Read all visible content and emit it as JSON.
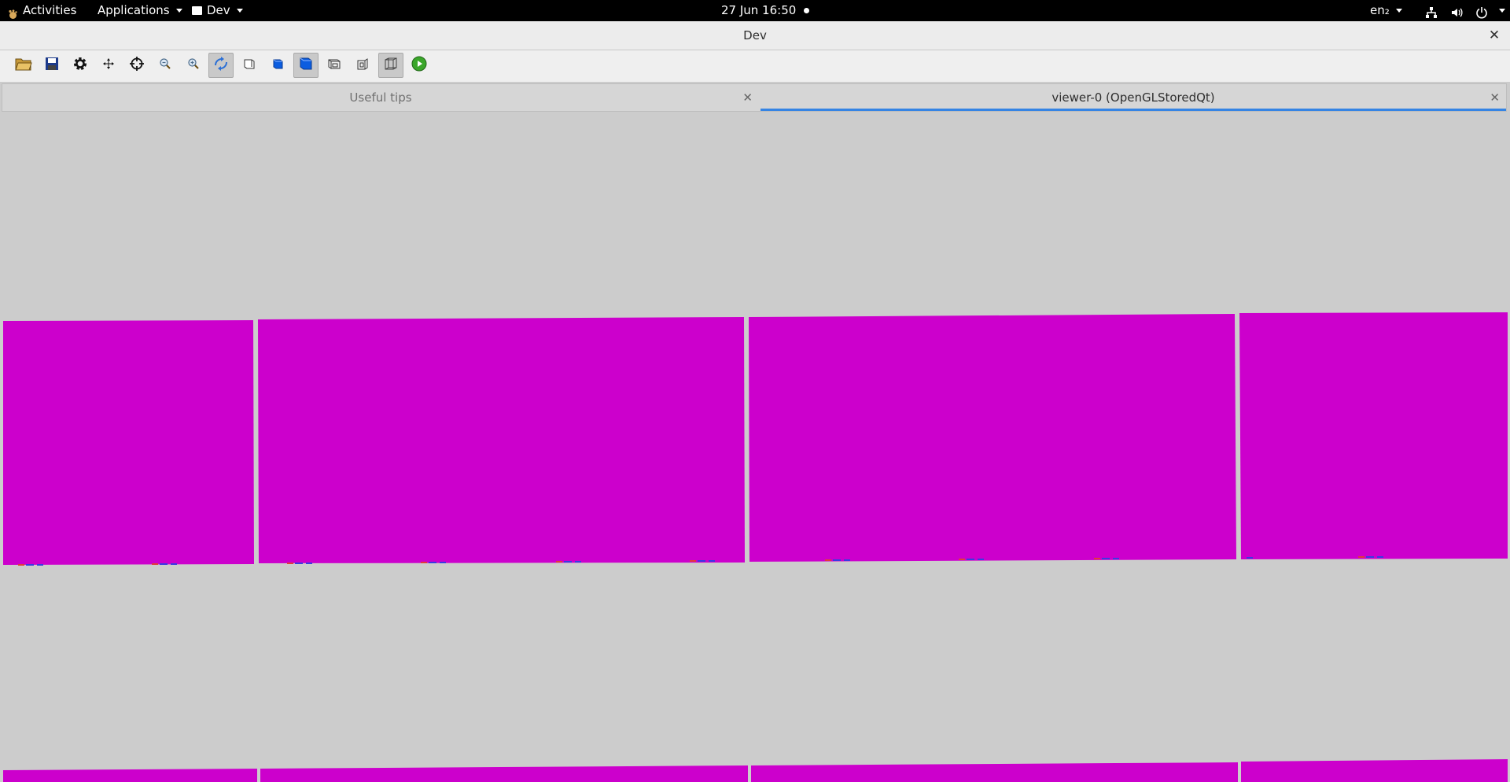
{
  "topbar": {
    "activities": "Activities",
    "applications": "Applications",
    "app_menu": "Dev",
    "clock": "27 Jun  16:50",
    "keyboard_layout": "en₂"
  },
  "window": {
    "title": "Dev"
  },
  "toolbar": {
    "buttons": [
      {
        "name": "open-icon"
      },
      {
        "name": "save-icon"
      },
      {
        "name": "settings-icon"
      },
      {
        "name": "move-icon"
      },
      {
        "name": "pick-target-icon"
      },
      {
        "name": "zoom-out-icon"
      },
      {
        "name": "zoom-in-icon"
      },
      {
        "name": "rotate-icon",
        "pressed": true
      },
      {
        "name": "hidden-line-icon"
      },
      {
        "name": "solid-surface-icon"
      },
      {
        "name": "solid-surface-selected-icon",
        "pressed": true
      },
      {
        "name": "perspective-icon"
      },
      {
        "name": "ortho-icon"
      },
      {
        "name": "wireframe-icon",
        "pressed": true
      },
      {
        "name": "run-icon"
      }
    ]
  },
  "tabs": [
    {
      "label": "Useful tips",
      "active": false
    },
    {
      "label": "viewer-0 (OpenGLStoredQt)",
      "active": true
    }
  ],
  "colors": {
    "tile": "#cc00cc",
    "background": "#cccccc",
    "accent": "#3584e4"
  }
}
